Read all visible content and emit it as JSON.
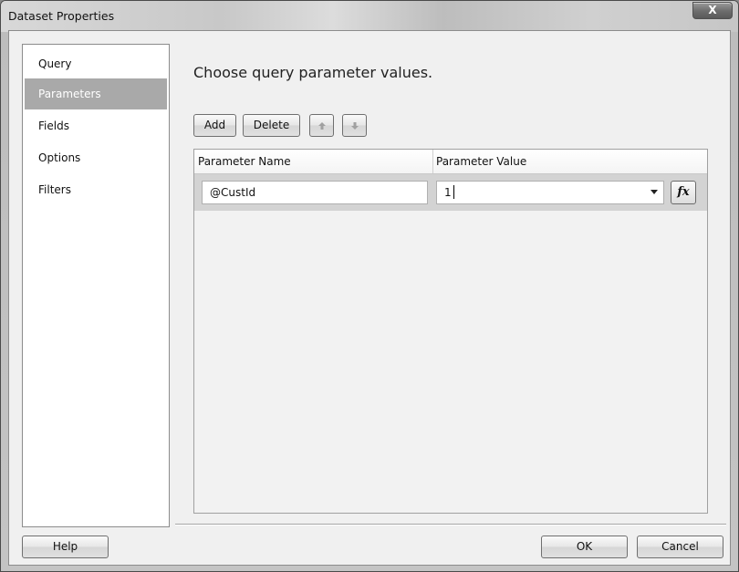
{
  "window": {
    "title": "Dataset Properties",
    "close_label": "X"
  },
  "nav": {
    "items": [
      {
        "label": "Query"
      },
      {
        "label": "Parameters",
        "selected": true
      },
      {
        "label": "Fields"
      },
      {
        "label": "Options"
      },
      {
        "label": "Filters"
      }
    ]
  },
  "main": {
    "heading": "Choose query parameter values.",
    "toolbar": {
      "add_label": "Add",
      "delete_label": "Delete",
      "move_up_icon": "arrow-up-icon",
      "move_down_icon": "arrow-down-icon"
    },
    "grid": {
      "columns": [
        "Parameter Name",
        "Parameter Value"
      ],
      "rows": [
        {
          "name": "@CustId",
          "value": "1",
          "expression_label": "fx"
        }
      ]
    }
  },
  "footer": {
    "help_label": "Help",
    "ok_label": "OK",
    "cancel_label": "Cancel"
  },
  "colors": {
    "selected_nav_bg": "#a9a9a9",
    "row_bg": "#d3d3d3"
  }
}
